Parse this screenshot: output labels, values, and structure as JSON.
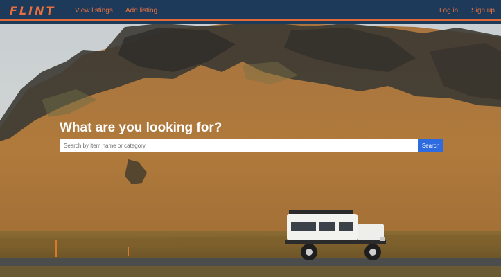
{
  "brand": {
    "logo_text": "FLINT",
    "accent_color": "#e8703e",
    "nav_bg": "#1d3a5a"
  },
  "nav": {
    "view_listings": "View listings",
    "add_listing": "Add listing",
    "log_in": "Log in",
    "sign_up": "Sign up"
  },
  "hero": {
    "title": "What are you looking for?",
    "search_placeholder": "Search by item name or category",
    "search_value": "",
    "search_button": "Search",
    "search_button_color": "#2f6be0"
  }
}
